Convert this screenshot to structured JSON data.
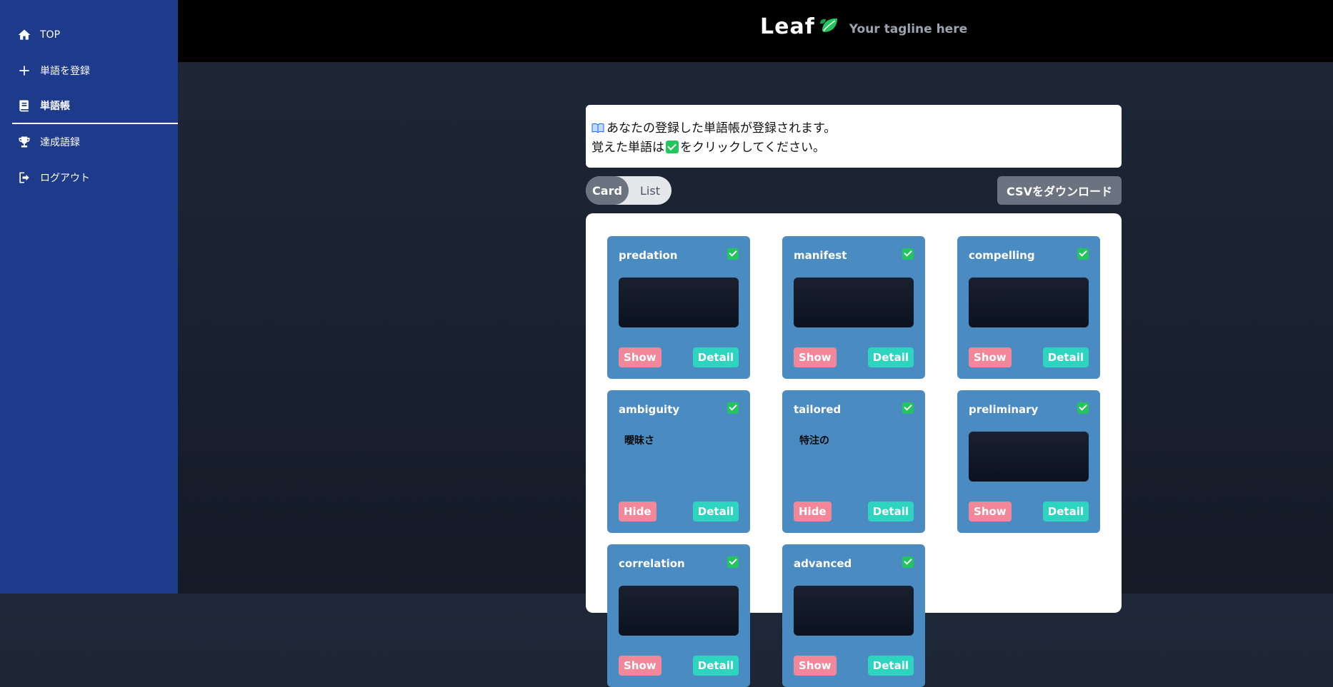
{
  "sidebar": {
    "items": [
      {
        "label": "TOP",
        "icon": "home-icon"
      },
      {
        "label": "単語を登録",
        "icon": "plus-icon"
      },
      {
        "label": "単語帳",
        "icon": "book-icon"
      },
      {
        "label": "達成語録",
        "icon": "trophy-icon"
      },
      {
        "label": "ログアウト",
        "icon": "logout-icon"
      }
    ],
    "active_index": 2
  },
  "header": {
    "logo": "Leaf",
    "tagline": "Your tagline here"
  },
  "notice": {
    "line1": "あなたの登録した単語帳が登録されます。",
    "line2_prefix": "覚えた単語は",
    "line2_suffix": "をクリックしてください。"
  },
  "view_toggle": {
    "card": "Card",
    "list": "List",
    "selected": "Card"
  },
  "csv_button": "CSVをダウンロード",
  "cards": [
    {
      "word": "predation",
      "meaning": "",
      "hidden": true,
      "toggle": "Show",
      "detail": "Detail"
    },
    {
      "word": "manifest",
      "meaning": "",
      "hidden": true,
      "toggle": "Show",
      "detail": "Detail"
    },
    {
      "word": "compelling",
      "meaning": "",
      "hidden": true,
      "toggle": "Show",
      "detail": "Detail"
    },
    {
      "word": "ambiguity",
      "meaning": "曖昧さ",
      "hidden": false,
      "toggle": "Hide",
      "detail": "Detail"
    },
    {
      "word": "tailored",
      "meaning": "特注の",
      "hidden": false,
      "toggle": "Hide",
      "detail": "Detail"
    },
    {
      "word": "preliminary",
      "meaning": "",
      "hidden": true,
      "toggle": "Show",
      "detail": "Detail"
    },
    {
      "word": "correlation",
      "meaning": "",
      "hidden": true,
      "toggle": "Show",
      "detail": "Detail"
    },
    {
      "word": "advanced",
      "meaning": "",
      "hidden": true,
      "toggle": "Show",
      "detail": "Detail"
    }
  ],
  "colors": {
    "sidebar": "#1e3a8a",
    "card": "#4a8bc2",
    "check": "#22c55e",
    "show_button": "#f3879a",
    "detail_button": "#2dd4bf"
  }
}
